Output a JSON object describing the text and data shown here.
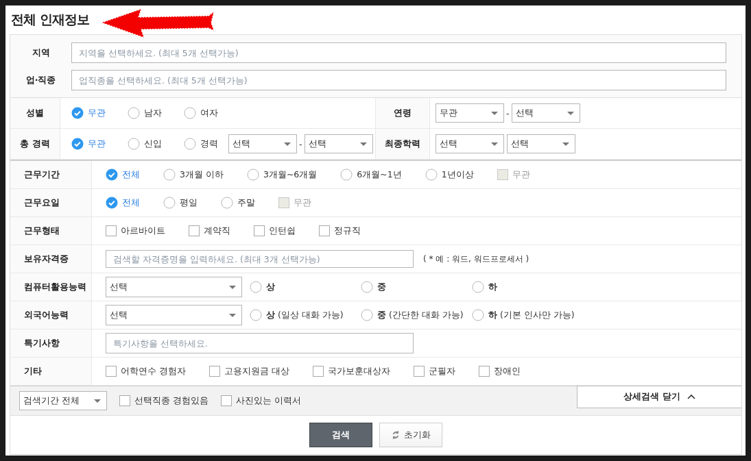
{
  "title": "전체 인재정보",
  "location_fields": [
    {
      "label": "지역",
      "placeholder": "지역을 선택하세요. (최대 5개 선택가능)"
    },
    {
      "label": "업·직종",
      "placeholder": "업직종을 선택하세요. (최대 5개 선택가능)"
    }
  ],
  "basic_rows": [
    {
      "left": {
        "label": "성별",
        "options": [
          {
            "kind": "radio",
            "label": "무관",
            "checked": true,
            "disabled": false
          },
          {
            "kind": "radio",
            "label": "남자",
            "checked": false,
            "disabled": false
          },
          {
            "kind": "radio",
            "label": "여자",
            "checked": false,
            "disabled": false
          }
        ]
      },
      "right": {
        "label": "연령",
        "selects": [
          "무관",
          "선택"
        ],
        "separator": "-"
      }
    },
    {
      "left": {
        "label": "총 경력",
        "options": [
          {
            "kind": "radio",
            "label": "무관",
            "checked": true,
            "disabled": false
          },
          {
            "kind": "radio",
            "label": "신입",
            "checked": false,
            "disabled": false
          },
          {
            "kind": "radio",
            "label": "경력",
            "checked": false,
            "disabled": false
          }
        ],
        "selects": [
          "선택",
          "선택"
        ],
        "separator": "-"
      },
      "right": {
        "label": "최종학력",
        "selects": [
          "선택",
          "선택"
        ]
      }
    }
  ],
  "detail_rows": [
    {
      "kind": "options",
      "label": "근무기간",
      "options": [
        {
          "kind": "radio",
          "label": "전체",
          "checked": true,
          "disabled": false
        },
        {
          "kind": "radio",
          "label": "3개월 이하",
          "checked": false,
          "disabled": false
        },
        {
          "kind": "radio",
          "label": "3개월~6개월",
          "checked": false,
          "disabled": false
        },
        {
          "kind": "radio",
          "label": "6개월~1년",
          "checked": false,
          "disabled": false
        },
        {
          "kind": "radio",
          "label": "1년이상",
          "checked": false,
          "disabled": false
        },
        {
          "kind": "checkbox",
          "label": "무관",
          "checked": false,
          "disabled": true
        }
      ]
    },
    {
      "kind": "options",
      "label": "근무요일",
      "options": [
        {
          "kind": "radio",
          "label": "전체",
          "checked": true,
          "disabled": false
        },
        {
          "kind": "radio",
          "label": "평일",
          "checked": false,
          "disabled": false
        },
        {
          "kind": "radio",
          "label": "주말",
          "checked": false,
          "disabled": false
        },
        {
          "kind": "checkbox",
          "label": "무관",
          "checked": false,
          "disabled": true
        }
      ]
    },
    {
      "kind": "options",
      "label": "근무형태",
      "options": [
        {
          "kind": "checkbox",
          "label": "아르바이트",
          "checked": false,
          "disabled": false
        },
        {
          "kind": "checkbox",
          "label": "계약직",
          "checked": false,
          "disabled": false
        },
        {
          "kind": "checkbox",
          "label": "인턴쉽",
          "checked": false,
          "disabled": false
        },
        {
          "kind": "checkbox",
          "label": "정규직",
          "checked": false,
          "disabled": false
        }
      ]
    },
    {
      "kind": "input",
      "label": "보유자격증",
      "placeholder": "검색할 자격증명을 입력하세요. (최대 3개 선택가능)",
      "note": "( * 예 : 워드, 워드프로세서 )"
    },
    {
      "kind": "grade",
      "label": "컴퓨터활용능력",
      "select": "선택",
      "options": [
        {
          "kind": "radio",
          "label": "상",
          "checked": false,
          "disabled": false
        },
        {
          "kind": "radio",
          "label": "중",
          "checked": false,
          "disabled": false
        },
        {
          "kind": "radio",
          "label": "하",
          "checked": false,
          "disabled": false
        }
      ]
    },
    {
      "kind": "grade_note",
      "label": "외국어능력",
      "select": "선택",
      "options": [
        {
          "kind": "radio",
          "label": "**상** (일상 대화 가능)",
          "checked": false,
          "disabled": false
        },
        {
          "kind": "radio",
          "label": "**중** (간단한 대화 가능)",
          "checked": false,
          "disabled": false
        },
        {
          "kind": "radio",
          "label": "**하** (기본 인사만 가능)",
          "checked": false,
          "disabled": false
        }
      ]
    },
    {
      "kind": "input",
      "label": "특기사항",
      "placeholder": "특기사항을 선택하세요."
    },
    {
      "kind": "options",
      "label": "기타",
      "options": [
        {
          "kind": "checkbox",
          "label": "어학연수 경험자",
          "checked": false,
          "disabled": false
        },
        {
          "kind": "checkbox",
          "label": "고용지원금 대상",
          "checked": false,
          "disabled": false
        },
        {
          "kind": "checkbox",
          "label": "국가보훈대상자",
          "checked": false,
          "disabled": false
        },
        {
          "kind": "checkbox",
          "label": "군필자",
          "checked": false,
          "disabled": false
        },
        {
          "kind": "checkbox",
          "label": "장애인",
          "checked": false,
          "disabled": false
        }
      ]
    }
  ],
  "footer": {
    "period_select": "검색기간 전체",
    "options": [
      {
        "kind": "checkbox",
        "label": "선택직종 경험있음",
        "checked": false,
        "disabled": false
      },
      {
        "kind": "checkbox",
        "label": "사진있는 이력서",
        "checked": false,
        "disabled": false
      }
    ],
    "toggle_button": "상세검색 닫기"
  },
  "buttons": {
    "search": "검색",
    "reset": "초기화"
  }
}
